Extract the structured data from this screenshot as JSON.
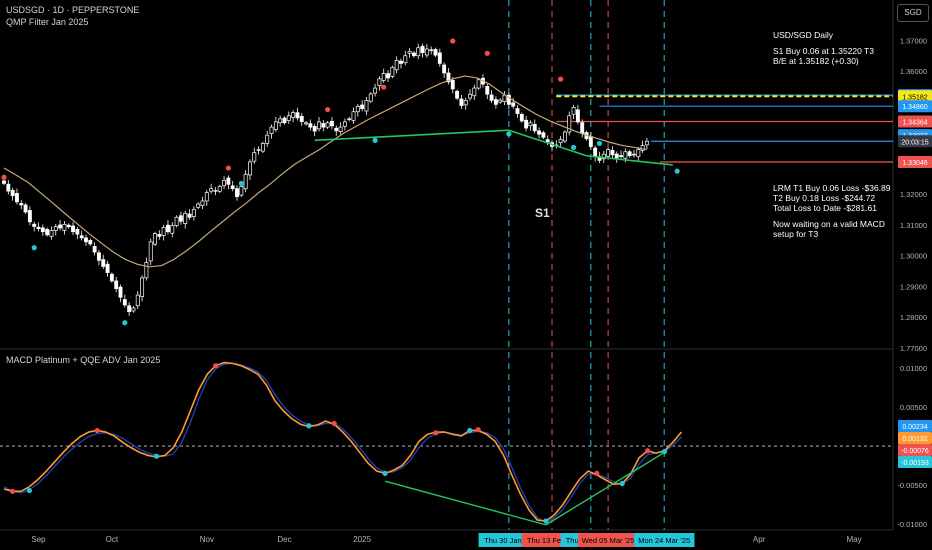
{
  "header": {
    "title": "USDSGD · 1D · PEPPERSTONE",
    "indicator": "QMP Filter Jan 2025",
    "macd_title": "MACD Platinum + QQE ADV Jan 2025",
    "currency_button": "SGD",
    "s1_label": "S1"
  },
  "notes": {
    "top": [
      "USD/SGD Daily",
      "",
      "S1 Buy 0.06 at 1.35220 T3",
      "B/E at 1.35182 (+0.30)"
    ],
    "bottom": [
      "LRM T1 Buy 0.06 Loss -$36.89",
      "T2 Buy 0.18 Loss -$244.72",
      "Total Loss to Date -$281.61",
      "",
      "Now waiting on a valid MACD",
      "setup for T3"
    ]
  },
  "colors": {
    "background": "#000000",
    "up_candle": "#ffffff",
    "down_candle": "#ffffff",
    "ma_line": "#c9a77a",
    "trendline": "#22c55e",
    "dot_red": "#f24c4c",
    "dot_cyan": "#26c6da",
    "vline_cyan": "#26c6da",
    "vline_red": "#ef5350",
    "macd_line": "#ff9a2e",
    "signal_line": "#1e40af",
    "yellow": "#f7e51d",
    "blue_line": "#2196f3"
  },
  "chart_data": {
    "type": "candlestick",
    "price_axis": {
      "min": 1.27,
      "max": 1.375,
      "ticks": [
        1.37,
        1.36,
        1.35,
        1.34,
        1.33,
        1.32,
        1.31,
        1.3,
        1.29,
        1.28,
        1.27
      ],
      "tick_labels": [
        "1.37000",
        "1.36000",
        "1.35000",
        "1.34000",
        "1.33000",
        "1.32000",
        "1.31000",
        "1.30000",
        "1.29000",
        "1.28000",
        "1.77000"
      ]
    },
    "price_tags": [
      {
        "label": "1.35220",
        "value": 1.3522,
        "color": "#2196f3",
        "text_color": "#ffffff"
      },
      {
        "label": "1.35182",
        "value": 1.35182,
        "color": "#f7e51d",
        "text_color": "#000000"
      },
      {
        "label": "1.34860",
        "value": 1.3486,
        "color": "#2196f3",
        "text_color": "#ffffff"
      },
      {
        "label": "1.34364",
        "value": 1.34364,
        "color": "#ef5350",
        "text_color": "#ffffff"
      },
      {
        "label": "1.33922",
        "value": 1.33922,
        "color": "#2196f3",
        "text_color": "#ffffff"
      },
      {
        "label": "20:03:15",
        "value": 1.3372,
        "color": "#363a45",
        "text_color": "#ffffff"
      },
      {
        "label": "1.33046",
        "value": 1.33046,
        "color": "#ef5350",
        "text_color": "#ffffff"
      }
    ],
    "horizontal_lines": [
      {
        "value": 1.3522,
        "color": "#2196f3",
        "style": "solid",
        "from_day": 128
      },
      {
        "value": 1.35182,
        "color": "#f7e51d",
        "style": "dashed",
        "from_day": 128
      },
      {
        "value": 1.3486,
        "color": "#2196f3",
        "style": "solid",
        "from_day": 138
      },
      {
        "value": 1.34364,
        "color": "#ef5350",
        "style": "solid",
        "from_day": 128
      },
      {
        "value": 1.3372,
        "color": "#2196f3",
        "style": "solid",
        "from_day": 150
      },
      {
        "value": 1.33046,
        "color": "#ef5350",
        "style": "solid",
        "from_day": 152
      }
    ],
    "closes": [
      1.3235,
      1.321,
      1.3195,
      1.3175,
      1.3165,
      1.3142,
      1.311,
      1.3095,
      1.3088,
      1.3078,
      1.3068,
      1.3082,
      1.3095,
      1.309,
      1.3102,
      1.3094,
      1.3078,
      1.307,
      1.3058,
      1.3045,
      1.3038,
      1.3012,
      1.2985,
      1.2965,
      1.2945,
      1.2918,
      1.2893,
      1.2865,
      1.284,
      1.2818,
      1.283,
      1.2872,
      1.2928,
      1.2978,
      1.3045,
      1.3072,
      1.3063,
      1.3092,
      1.3078,
      1.3098,
      1.3125,
      1.3112,
      1.3138,
      1.3125,
      1.315,
      1.3168,
      1.3178,
      1.3205,
      1.3218,
      1.3212,
      1.3225,
      1.3245,
      1.3232,
      1.3218,
      1.3192,
      1.3225,
      1.3265,
      1.3305,
      1.3335,
      1.3345,
      1.3365,
      1.3392,
      1.3418,
      1.3435,
      1.3445,
      1.3432,
      1.3455,
      1.3465,
      1.3448,
      1.3436,
      1.3432,
      1.3418,
      1.3405,
      1.3435,
      1.3418,
      1.3432,
      1.3422,
      1.3406,
      1.3418,
      1.3435,
      1.3445,
      1.3468,
      1.3485,
      1.3478,
      1.3505,
      1.3526,
      1.3545,
      1.3575,
      1.3592,
      1.3578,
      1.3612,
      1.3635,
      1.3625,
      1.365,
      1.3664,
      1.365,
      1.3676,
      1.366,
      1.3672,
      1.3668,
      1.3652,
      1.3625,
      1.3594,
      1.3565,
      1.3542,
      1.3512,
      1.3488,
      1.3505,
      1.3525,
      1.3545,
      1.3572,
      1.3558,
      1.3525,
      1.3505,
      1.3492,
      1.3506,
      1.3522,
      1.3492,
      1.3486,
      1.3462,
      1.3438,
      1.3415,
      1.3432,
      1.3406,
      1.3395,
      1.3385,
      1.337,
      1.3355,
      1.336,
      1.3378,
      1.3402,
      1.3455,
      1.3482,
      1.3435,
      1.3398,
      1.338,
      1.3355,
      1.3322,
      1.331,
      1.333,
      1.3345,
      1.3328,
      1.3318,
      1.3322,
      1.3338,
      1.3325,
      1.333,
      1.3345,
      1.3358,
      1.3372
    ],
    "ma_curve": [
      1.3285,
      1.3262,
      1.3238,
      1.3205,
      1.3172,
      1.3138,
      1.3105,
      1.3072,
      1.3042,
      1.3012,
      1.2988,
      1.2972,
      1.2964,
      1.2968,
      1.2988,
      1.3015,
      1.3045,
      1.3078,
      1.311,
      1.3142,
      1.3172,
      1.3205,
      1.3235,
      1.3268,
      1.3298,
      1.3322,
      1.3345,
      1.3372,
      1.3398,
      1.342,
      1.3442,
      1.3462,
      1.3482,
      1.3502,
      1.3522,
      1.3542,
      1.356,
      1.3575,
      1.3584,
      1.3578,
      1.3558,
      1.353,
      1.3504,
      1.348,
      1.3457,
      1.3438,
      1.3422,
      1.3406,
      1.3392,
      1.338,
      1.3368,
      1.3358,
      1.3352,
      1.3345
    ],
    "markers": [
      {
        "day": 0,
        "value": 1.3255,
        "color": "red"
      },
      {
        "day": 7,
        "value": 1.3026,
        "color": "cyan"
      },
      {
        "day": 28,
        "value": 1.2782,
        "color": "cyan"
      },
      {
        "day": 52,
        "value": 1.3285,
        "color": "red"
      },
      {
        "day": 55,
        "value": 1.3235,
        "color": "cyan"
      },
      {
        "day": 75,
        "value": 1.3475,
        "color": "red"
      },
      {
        "day": 88,
        "value": 1.3548,
        "color": "red"
      },
      {
        "day": 86,
        "value": 1.3375,
        "color": "cyan"
      },
      {
        "day": 104,
        "value": 1.3698,
        "color": "red"
      },
      {
        "day": 112,
        "value": 1.3658,
        "color": "red"
      },
      {
        "day": 117,
        "value": 1.3396,
        "color": "cyan"
      },
      {
        "day": 129,
        "value": 1.3574,
        "color": "red"
      },
      {
        "day": 132,
        "value": 1.3352,
        "color": "cyan"
      },
      {
        "day": 138,
        "value": 1.3365,
        "color": "cyan"
      },
      {
        "day": 156,
        "value": 1.3275,
        "color": "cyan"
      }
    ],
    "trendlines_price": [
      {
        "d1": 72,
        "v1": 1.3375,
        "d2": 117,
        "v2": 1.3408
      },
      {
        "d1": 117,
        "v1": 1.3408,
        "d2": 135,
        "v2": 1.3325
      },
      {
        "d1": 135,
        "v1": 1.3325,
        "d2": 155,
        "v2": 1.3295
      }
    ],
    "macd_axis": {
      "min": -0.0105,
      "max": 0.0118,
      "ticks": [
        0.01,
        0.005,
        0,
        -0.005,
        -0.01
      ],
      "tick_labels": [
        "0.01000",
        "0.00500",
        "0.00000",
        "-0.00500",
        "-0.01000"
      ]
    },
    "macd_tags": [
      {
        "label": "0.00234",
        "value": 0.00234,
        "color": "#2196f3"
      },
      {
        "label": "0.00132",
        "value": 0.00132,
        "color": "#ff9a2e"
      },
      {
        "label": "-0.00076",
        "value": -0.00076,
        "color": "#ef5350"
      },
      {
        "label": "-0.00193",
        "value": -0.00193,
        "color": "#26c6da"
      }
    ],
    "macd": [
      -0.0055,
      -0.0058,
      -0.0058,
      -0.0052,
      -0.0043,
      -0.0032,
      -0.002,
      -0.0008,
      0.0003,
      0.0012,
      0.0018,
      0.002,
      0.0018,
      0.0013,
      0.0005,
      -0.0002,
      -0.0008,
      -0.0012,
      -0.0014,
      -0.0012,
      -0.0002,
      0.0018,
      0.0045,
      0.0072,
      0.0092,
      0.0103,
      0.0107,
      0.0106,
      0.0103,
      0.0098,
      0.0092,
      0.0078,
      0.0058,
      0.0045,
      0.0035,
      0.0028,
      0.0025,
      0.0027,
      0.0032,
      0.0028,
      0.0018,
      0.0006,
      -0.0008,
      -0.0022,
      -0.0032,
      -0.0035,
      -0.0031,
      -0.0025,
      -0.0012,
      0.0006,
      0.0015,
      0.0018,
      0.0018,
      0.0015,
      0.0013,
      0.002,
      0.002,
      0.0015,
      0.0006,
      -0.0012,
      -0.0038,
      -0.0062,
      -0.0082,
      -0.0095,
      -0.0096,
      -0.0088,
      -0.0075,
      -0.0058,
      -0.0042,
      -0.0032,
      -0.0037,
      -0.0043,
      -0.0049,
      -0.0048,
      -0.0036,
      -0.0015,
      -0.0006,
      -0.0009,
      -0.0006,
      0.0005,
      0.0018
    ],
    "signal": [
      -0.0052,
      -0.0058,
      -0.006,
      -0.0056,
      -0.0048,
      -0.0038,
      -0.0026,
      -0.0014,
      -0.0004,
      0.0005,
      0.0012,
      0.0016,
      0.0017,
      0.0015,
      0.001,
      0.0003,
      -0.0004,
      -0.0009,
      -0.0012,
      -0.0013,
      -0.001,
      0.0005,
      0.003,
      0.006,
      0.0085,
      0.0099,
      0.0105,
      0.0106,
      0.0104,
      0.01,
      0.0095,
      0.0084,
      0.0066,
      0.0051,
      0.004,
      0.0032,
      0.0027,
      0.0026,
      0.0029,
      0.0029,
      0.0022,
      0.0011,
      -0.0002,
      -0.0016,
      -0.0028,
      -0.0034,
      -0.0033,
      -0.0028,
      -0.0018,
      -0.0002,
      0.001,
      0.0016,
      0.0018,
      0.0016,
      0.0014,
      0.0017,
      0.0019,
      0.0017,
      0.0011,
      -0.0004,
      -0.0028,
      -0.0054,
      -0.0076,
      -0.0092,
      -0.0098,
      -0.0092,
      -0.0081,
      -0.0065,
      -0.0048,
      -0.0036,
      -0.0036,
      -0.004,
      -0.0046,
      -0.0049,
      -0.0041,
      -0.0023,
      -0.0011,
      -0.0009,
      -0.0007,
      0.0001,
      0.0012
    ],
    "macd_markers": [
      {
        "i": 1,
        "value": -0.0058,
        "color": "red"
      },
      {
        "i": 3,
        "value": -0.0057,
        "color": "cyan"
      },
      {
        "i": 11,
        "value": 0.002,
        "color": "red"
      },
      {
        "i": 18,
        "value": -0.0013,
        "color": "cyan"
      },
      {
        "i": 25,
        "value": 0.0103,
        "color": "red"
      },
      {
        "i": 36,
        "value": 0.0026,
        "color": "cyan"
      },
      {
        "i": 39,
        "value": 0.0029,
        "color": "red"
      },
      {
        "i": 45,
        "value": -0.0035,
        "color": "cyan"
      },
      {
        "i": 51,
        "value": 0.0017,
        "color": "red"
      },
      {
        "i": 55,
        "value": 0.002,
        "color": "cyan"
      },
      {
        "i": 56,
        "value": 0.0021,
        "color": "red"
      },
      {
        "i": 64,
        "value": -0.0096,
        "color": "cyan"
      },
      {
        "i": 70,
        "value": -0.0035,
        "color": "red"
      },
      {
        "i": 73,
        "value": -0.0048,
        "color": "cyan"
      },
      {
        "i": 76,
        "value": -0.0006,
        "color": "red"
      },
      {
        "i": 78,
        "value": -0.0007,
        "color": "cyan"
      }
    ],
    "trendlines_macd": [
      {
        "i1": 45,
        "v1": -0.0045,
        "i2": 64,
        "v2": -0.0101
      },
      {
        "i1": 64,
        "v1": -0.0101,
        "i2": 78,
        "v2": -0.0008
      }
    ],
    "time_axis": {
      "labels": [
        {
          "label": "Sep",
          "day": 8
        },
        {
          "label": "Oct",
          "day": 25
        },
        {
          "label": "Nov",
          "day": 47
        },
        {
          "label": "Dec",
          "day": 65
        },
        {
          "label": "2025",
          "day": 83
        },
        {
          "label": "Apr",
          "day": 175
        },
        {
          "label": "May",
          "day": 197
        }
      ],
      "event_lines": [
        {
          "label": "Thu 30 Jan '25",
          "day": 117,
          "color": "#26c6da"
        },
        {
          "label": "Thu 13 Feb '25",
          "day": 127,
          "color": "#ef5350"
        },
        {
          "label": "Thu 27 Feb '25",
          "day": 136,
          "color": "#26c6da"
        },
        {
          "label": "Wed 05 Mar '25",
          "day": 140,
          "color": "#ef5350"
        },
        {
          "label": "Mon 24 Mar '25",
          "day": 153,
          "color": "#26c6da"
        }
      ]
    }
  }
}
